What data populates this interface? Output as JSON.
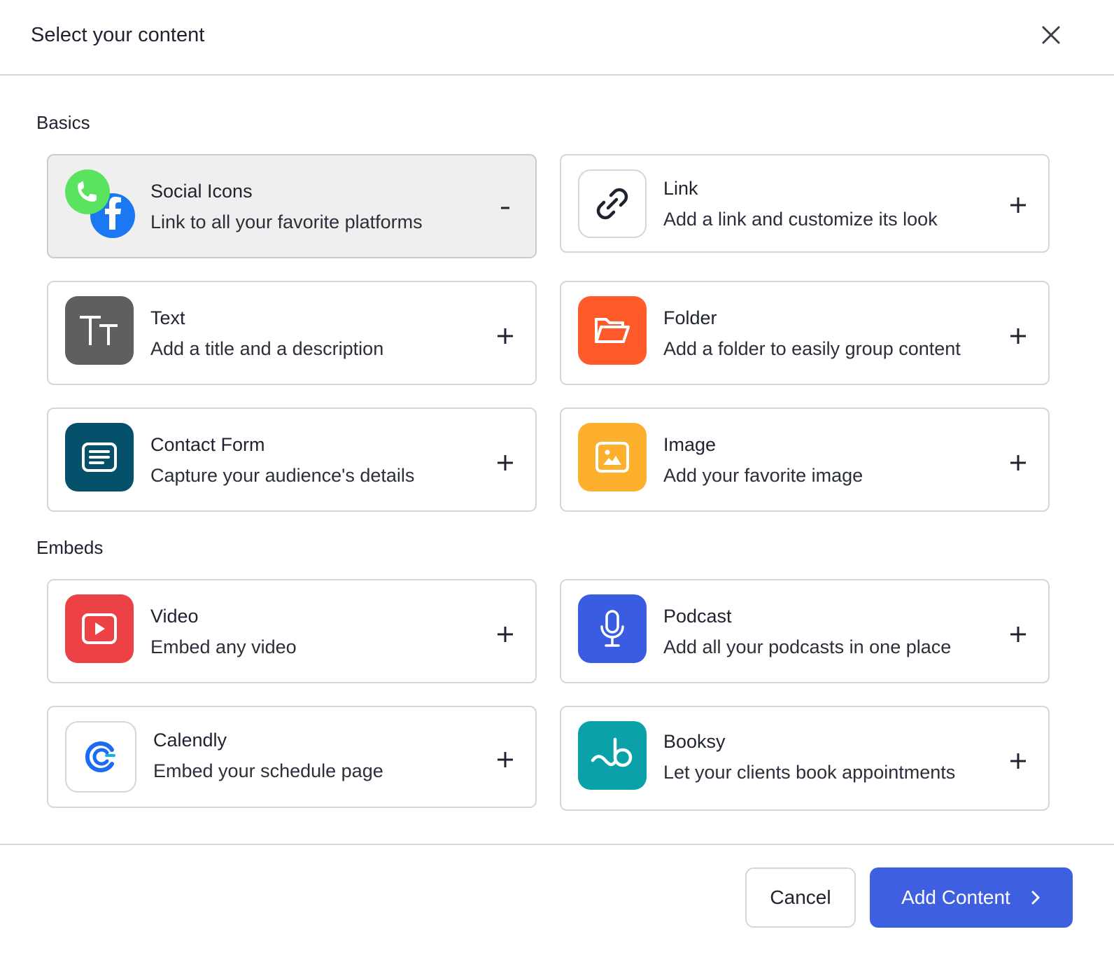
{
  "modal": {
    "title": "Select your content"
  },
  "sections": {
    "basics": "Basics",
    "embeds": "Embeds"
  },
  "cards": {
    "social": {
      "name": "Social Icons",
      "desc": "Link to all your favorite platforms",
      "action": "-"
    },
    "link": {
      "name": "Link",
      "desc": "Add a link and customize its look",
      "action": "+"
    },
    "text": {
      "name": "Text",
      "desc": "Add a title and a description",
      "action": "+"
    },
    "folder": {
      "name": "Folder",
      "desc": "Add a folder to easily group content",
      "action": "+"
    },
    "contact": {
      "name": "Contact Form",
      "desc": "Capture your audience's details",
      "action": "+"
    },
    "image": {
      "name": "Image",
      "desc": "Add your favorite image",
      "action": "+"
    },
    "video": {
      "name": "Video",
      "desc": "Embed any video",
      "action": "+"
    },
    "podcast": {
      "name": "Podcast",
      "desc": "Add all your podcasts in one place",
      "action": "+"
    },
    "calendly": {
      "name": "Calendly",
      "desc": "Embed your schedule page",
      "action": "+"
    },
    "booksy": {
      "name": "Booksy",
      "desc": "Let your clients book appointments",
      "action": "+"
    }
  },
  "footer": {
    "cancel_label": "Cancel",
    "add_label": "Add Content"
  },
  "colors": {
    "primary": "#3e5fe0",
    "text_tile": "#5f5f5f",
    "folder_tile": "#ff5b2a",
    "contact_tile": "#05506b",
    "image_tile": "#fdb02e",
    "video_tile": "#ec4145",
    "podcast_tile": "#3a5ce0",
    "booksy_tile": "#0ba1a8",
    "whatsapp": "#5ae35e",
    "facebook": "#1b77f2"
  },
  "icons": {
    "close": "close-icon",
    "social": "social-icons-icon",
    "link": "link-icon",
    "text": "text-icon",
    "folder": "folder-icon",
    "contact": "form-icon",
    "image": "image-icon",
    "video": "video-play-icon",
    "podcast": "microphone-icon",
    "calendly": "calendly-logo-icon",
    "booksy": "booksy-logo-icon",
    "chevron": "chevron-right-icon"
  }
}
